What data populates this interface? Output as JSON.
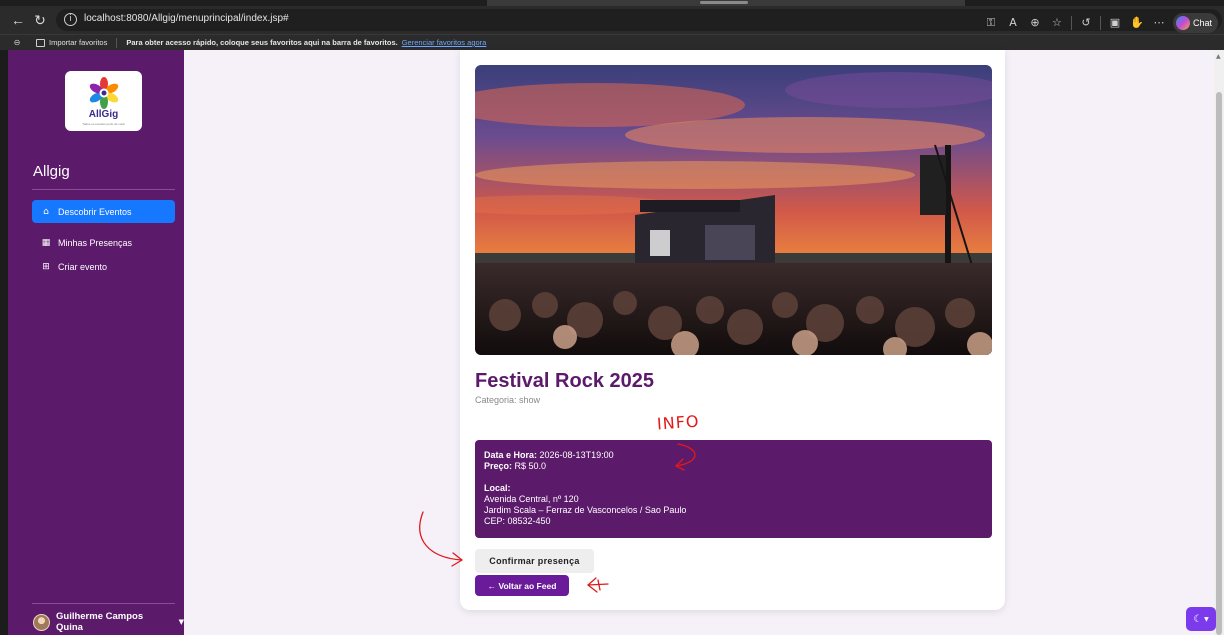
{
  "browser": {
    "url": "localhost:8080/Allgig/menuprincipal/index.jsp#",
    "chat_label": "Chat",
    "favorites": {
      "import_label": "Importar favoritos",
      "message": "Para obter acesso rápido, coloque seus favoritos aqui na barra de favoritos.",
      "manage_link": "Gerenciar favoritos agora"
    }
  },
  "sidebar": {
    "logo_brand": "AllGig",
    "logo_tagline": "Todos os eventos perto de você",
    "app_name": "Allgig",
    "nav": [
      {
        "label": "Descobrir Eventos",
        "icon": "home-icon",
        "active": true
      },
      {
        "label": "Minhas Presenças",
        "icon": "calendar-table-icon",
        "active": false
      },
      {
        "label": "Criar evento",
        "icon": "grid-icon",
        "active": false
      }
    ],
    "user_name": "Guilherme Campos Quina"
  },
  "event": {
    "title": "Festival Rock 2025",
    "category_label": "Categoria:",
    "category": "show",
    "datetime_label": "Data e Hora:",
    "datetime": "2026-08-13T19:00",
    "price_label": "Preço:",
    "price": "R$ 50.0",
    "location_label": "Local:",
    "address_line1": "Avenida Central, nº 120",
    "address_line2": "Jardim Scala – Ferraz de Vasconcelos / Sao Paulo",
    "cep": "CEP: 08532-450"
  },
  "actions": {
    "confirm_label": "Confirmar presença",
    "back_label": "← Voltar ao Feed"
  },
  "annotation": {
    "info_text": "INFO",
    "color": "#e11919"
  },
  "colors": {
    "sidebar_bg": "#5c1a6b",
    "active_nav": "#1677ff",
    "info_box_bg": "#5c1a6b",
    "back_button": "#6a1b9a",
    "page_bg": "#f6f1f9"
  }
}
